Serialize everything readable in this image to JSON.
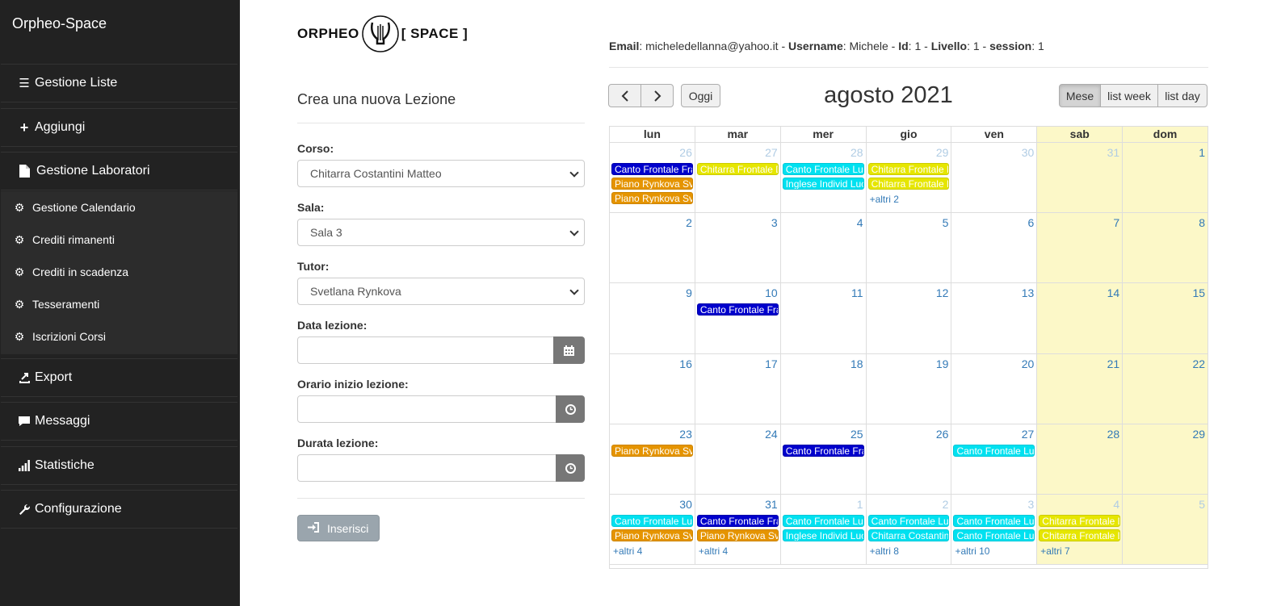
{
  "app": {
    "brand": "Orpheo-Space"
  },
  "sidebar": {
    "items": [
      {
        "label": "Gestione Liste",
        "icon": "list-icon"
      },
      {
        "label": "Aggiungi",
        "icon": "plus-icon"
      },
      {
        "label": "Gestione Laboratori",
        "icon": "file-icon"
      },
      {
        "label": "Export",
        "icon": "export-icon"
      },
      {
        "label": "Messaggi",
        "icon": "comment-icon"
      },
      {
        "label": "Statistiche",
        "icon": "stats-icon"
      },
      {
        "label": "Configurazione",
        "icon": "wrench-icon"
      }
    ],
    "subitems": [
      {
        "label": "Gestione Calendario",
        "icon": "cog-icon"
      },
      {
        "label": "Crediti rimanenti",
        "icon": "cog-icon"
      },
      {
        "label": "Crediti in scadenza",
        "icon": "cog-icon"
      },
      {
        "label": "Tesseramenti",
        "icon": "cog-icon"
      },
      {
        "label": "Iscrizioni Corsi",
        "icon": "cog-icon"
      }
    ]
  },
  "logo": {
    "left": "ORPHEO",
    "right": "[ SPACE ]"
  },
  "form": {
    "title": "Crea una nuova Lezione",
    "corso_label": "Corso:",
    "corso_value": "Chitarra Costantini Matteo",
    "sala_label": "Sala:",
    "sala_value": "Sala 3",
    "tutor_label": "Tutor:",
    "tutor_value": "Svetlana Rynkova",
    "data_label": "Data lezione:",
    "orario_label": "Orario inizio lezione:",
    "durata_label": "Durata lezione:",
    "submit_label": "Inserisci"
  },
  "userinfo": {
    "email_label": "Email",
    "email": "micheledellanna@yahoo.it",
    "username_label": "Username",
    "username": "Michele",
    "id_label": "Id",
    "id": "1",
    "livello_label": "Livello",
    "livello": "1",
    "session_label": "session",
    "session": "1"
  },
  "calendar": {
    "title": "agosto 2021",
    "today_label": "Oggi",
    "prev_icon": "chevron-left-icon",
    "next_icon": "chevron-right-icon",
    "views": [
      "Mese",
      "list week",
      "list day"
    ],
    "active_view": "Mese",
    "weekdays": [
      "lun",
      "mar",
      "mer",
      "gio",
      "ven",
      "sab",
      "dom"
    ],
    "colors": {
      "blue": "#0000cc",
      "orange": "#e59400",
      "cyan": "#00e1f0",
      "yellow": "#e6e600",
      "weekend": "#fcf8c8"
    },
    "weeks": [
      [
        {
          "n": "26",
          "other": true,
          "events": [
            {
              "t": "Canto Frontale Fra",
              "c": "blue"
            },
            {
              "t": "Piano Rynkova Svi",
              "c": "orange"
            },
            {
              "t": "Piano Rynkova Svi",
              "c": "orange"
            }
          ]
        },
        {
          "n": "27",
          "other": true,
          "events": [
            {
              "t": "Chitarra Frontale D",
              "c": "yellow"
            }
          ]
        },
        {
          "n": "28",
          "other": true,
          "events": [
            {
              "t": "Canto Frontale Luc",
              "c": "cyan"
            },
            {
              "t": "Inglese Individ Luc",
              "c": "cyan"
            }
          ]
        },
        {
          "n": "29",
          "other": true,
          "events": [
            {
              "t": "Chitarra Frontale D",
              "c": "yellow"
            },
            {
              "t": "Chitarra Frontale D",
              "c": "yellow"
            }
          ],
          "more": "+altri 2"
        },
        {
          "n": "30",
          "other": true,
          "events": []
        },
        {
          "n": "31",
          "other": true,
          "events": []
        },
        {
          "n": "1",
          "other": false,
          "events": []
        }
      ],
      [
        {
          "n": "2",
          "events": []
        },
        {
          "n": "3",
          "events": []
        },
        {
          "n": "4",
          "events": []
        },
        {
          "n": "5",
          "events": []
        },
        {
          "n": "6",
          "events": []
        },
        {
          "n": "7",
          "events": []
        },
        {
          "n": "8",
          "events": []
        }
      ],
      [
        {
          "n": "9",
          "events": []
        },
        {
          "n": "10",
          "events": [
            {
              "t": "Canto Frontale Fra",
              "c": "blue"
            }
          ]
        },
        {
          "n": "11",
          "events": []
        },
        {
          "n": "12",
          "events": []
        },
        {
          "n": "13",
          "events": []
        },
        {
          "n": "14",
          "events": []
        },
        {
          "n": "15",
          "events": []
        }
      ],
      [
        {
          "n": "16",
          "events": []
        },
        {
          "n": "17",
          "events": []
        },
        {
          "n": "18",
          "events": []
        },
        {
          "n": "19",
          "events": []
        },
        {
          "n": "20",
          "events": []
        },
        {
          "n": "21",
          "events": []
        },
        {
          "n": "22",
          "events": []
        }
      ],
      [
        {
          "n": "23",
          "events": [
            {
              "t": "Piano Rynkova Svi",
              "c": "orange"
            }
          ]
        },
        {
          "n": "24",
          "events": []
        },
        {
          "n": "25",
          "events": [
            {
              "t": "Canto Frontale Fra",
              "c": "blue"
            }
          ]
        },
        {
          "n": "26",
          "events": []
        },
        {
          "n": "27",
          "events": [
            {
              "t": "Canto Frontale Luc",
              "c": "cyan"
            }
          ]
        },
        {
          "n": "28",
          "events": []
        },
        {
          "n": "29",
          "events": []
        }
      ],
      [
        {
          "n": "30",
          "events": [
            {
              "t": "Canto Frontale Luc",
              "c": "cyan"
            },
            {
              "t": "Piano Rynkova Svi",
              "c": "orange"
            }
          ],
          "more": "+altri 4"
        },
        {
          "n": "31",
          "events": [
            {
              "t": "Canto Frontale Fra",
              "c": "blue"
            },
            {
              "t": "Piano Rynkova Svi",
              "c": "orange"
            }
          ],
          "more": "+altri 4"
        },
        {
          "n": "1",
          "other": true,
          "events": [
            {
              "t": "Canto Frontale Luc",
              "c": "cyan"
            },
            {
              "t": "Inglese Individ Luc",
              "c": "cyan"
            }
          ]
        },
        {
          "n": "2",
          "other": true,
          "events": [
            {
              "t": "Canto Frontale Luc",
              "c": "cyan"
            },
            {
              "t": "Chitarra Costantini",
              "c": "cyan"
            }
          ],
          "more": "+altri 8"
        },
        {
          "n": "3",
          "other": true,
          "events": [
            {
              "t": "Canto Frontale Luc",
              "c": "cyan"
            },
            {
              "t": "Canto Frontale Luc",
              "c": "cyan"
            }
          ],
          "more": "+altri 10"
        },
        {
          "n": "4",
          "other": true,
          "events": [
            {
              "t": "Chitarra Frontale D",
              "c": "yellow"
            },
            {
              "t": "Chitarra Frontale D",
              "c": "yellow"
            }
          ],
          "more": "+altri 7"
        },
        {
          "n": "5",
          "other": true,
          "events": []
        }
      ]
    ]
  }
}
